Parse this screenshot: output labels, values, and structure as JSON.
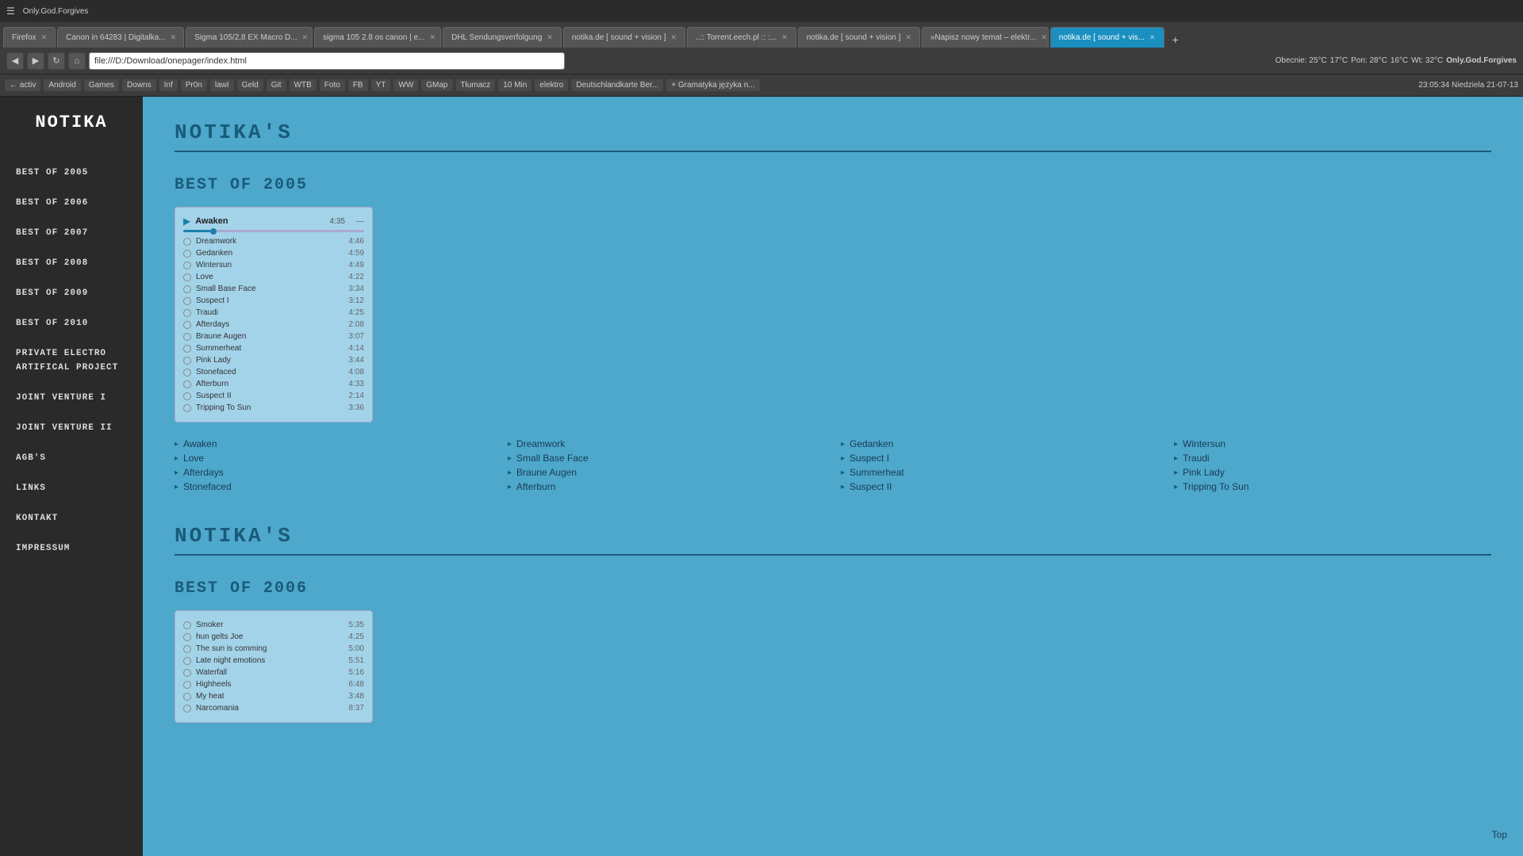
{
  "browser": {
    "tabs": [
      {
        "label": "Firefox",
        "active": false
      },
      {
        "label": "Canon in 64283 | Digitalka...",
        "active": false
      },
      {
        "label": "Sigma 105/2,8 EX Macro D...",
        "active": false
      },
      {
        "label": "sigma 105 2.8 os canon | e...",
        "active": false
      },
      {
        "label": "DHL Sendungsverfolgung",
        "active": false
      },
      {
        "label": "notika.de [ sound + vision ]",
        "active": false
      },
      {
        "label": "..:: Torrent.eech.pl :: :...",
        "active": false
      },
      {
        "label": "notika.de [ sound + vision ]",
        "active": false
      },
      {
        "label": "»Napisz nowy temat – elektr...",
        "active": false
      },
      {
        "label": "notika.de [ sound + vis...",
        "active": true
      }
    ],
    "address": "file:///D:/Download/onepager/index.html",
    "bookmarks": [
      "← activ",
      "Android",
      "Games",
      "Downs",
      "Inf",
      "Pr0n",
      "lawI",
      "Geld",
      "Git",
      "WTB",
      "Foto",
      "FB",
      "YT",
      "WW",
      "GMap",
      "Tłumacz",
      "10 Min",
      "elektro",
      "Deutschlandkarte Ber...",
      "+ Gramatyka języka n..."
    ]
  },
  "systemtray": {
    "time": "23:05:34 Niedziela 21-07-13",
    "weather": "Obecnie: 25°C",
    "temp1": "17°C",
    "temp2": "Pon: 28°C",
    "temp3": "16°C",
    "temp4": "Wt: 32°C",
    "torrent": "Only.God.Forgives"
  },
  "sidebar": {
    "logo": "NOTIKA",
    "nav": [
      {
        "label": "Best of 2005",
        "id": "best2005"
      },
      {
        "label": "Best of 2006",
        "id": "best2006"
      },
      {
        "label": "Best of 2007",
        "id": "best2007"
      },
      {
        "label": "Best of 2008",
        "id": "best2008"
      },
      {
        "label": "Best of 2009",
        "id": "best2009"
      },
      {
        "label": "Best of 2010",
        "id": "best2010"
      },
      {
        "label": "Private Electro Artifical Project",
        "id": "peap"
      },
      {
        "label": "Joint Venture I",
        "id": "jv1"
      },
      {
        "label": "Joint Venture II",
        "id": "jv2"
      },
      {
        "label": "AGB's",
        "id": "agbs"
      },
      {
        "label": "Links",
        "id": "links"
      },
      {
        "label": "Kontakt",
        "id": "kontakt"
      },
      {
        "label": "Impressum",
        "id": "impressum"
      }
    ]
  },
  "main": {
    "site_title": "NOTIKA'S",
    "sections": [
      {
        "id": "best2005",
        "title": "BEST OF 2005",
        "player": {
          "now_playing": "Awaken",
          "time": "4:35",
          "progress_percent": 15
        },
        "tracks": [
          {
            "name": "Awaken",
            "duration": "—",
            "playing": true
          },
          {
            "name": "Dreamwork",
            "duration": "4:46"
          },
          {
            "name": "Gedanken",
            "duration": "4:59"
          },
          {
            "name": "Wintersun",
            "duration": "4:49"
          },
          {
            "name": "Love",
            "duration": "4:22"
          },
          {
            "name": "Small Base Face",
            "duration": "3:34"
          },
          {
            "name": "Suspect I",
            "duration": "3:12"
          },
          {
            "name": "Traudi",
            "duration": "4:25"
          },
          {
            "name": "Afterdays",
            "duration": "2:08"
          },
          {
            "name": "Braune Augen",
            "duration": "3:07"
          },
          {
            "name": "Summerheat",
            "duration": "4:14"
          },
          {
            "name": "Pink Lady",
            "duration": "3:44"
          },
          {
            "name": "Stonefaced",
            "duration": "4:08"
          },
          {
            "name": "Afterburn",
            "duration": "4:33"
          },
          {
            "name": "Suspect II",
            "duration": "2:14"
          },
          {
            "name": "Tripping To Sun",
            "duration": "3:36"
          }
        ],
        "track_columns": [
          [
            "Awaken",
            "Love",
            "Afterdays",
            "Stonefaced"
          ],
          [
            "Dreamwork",
            "Small Base Face",
            "Braune Augen",
            "Afterburn"
          ],
          [
            "Gedanken",
            "Suspect I",
            "Summerheat",
            "Suspect II"
          ],
          [
            "Wintersun",
            "Traudi",
            "Pink Lady",
            "Tripping To Sun"
          ]
        ]
      },
      {
        "id": "best2006",
        "title": "BEST OF 2006",
        "player": {
          "now_playing": "",
          "time": ""
        },
        "tracks": [
          {
            "name": "Smoker",
            "duration": "5:35"
          },
          {
            "name": "hun gelts Joe",
            "duration": "4:25"
          },
          {
            "name": "The sun is comming",
            "duration": "5:00"
          },
          {
            "name": "Late night emotions",
            "duration": "5:51"
          },
          {
            "name": "Waterfall",
            "duration": "5:16"
          },
          {
            "name": "Highheels",
            "duration": "6:48"
          },
          {
            "name": "My heat",
            "duration": "3:48"
          },
          {
            "name": "Narcomania",
            "duration": "8:37"
          }
        ],
        "track_columns": []
      }
    ],
    "top_label": "Top"
  }
}
